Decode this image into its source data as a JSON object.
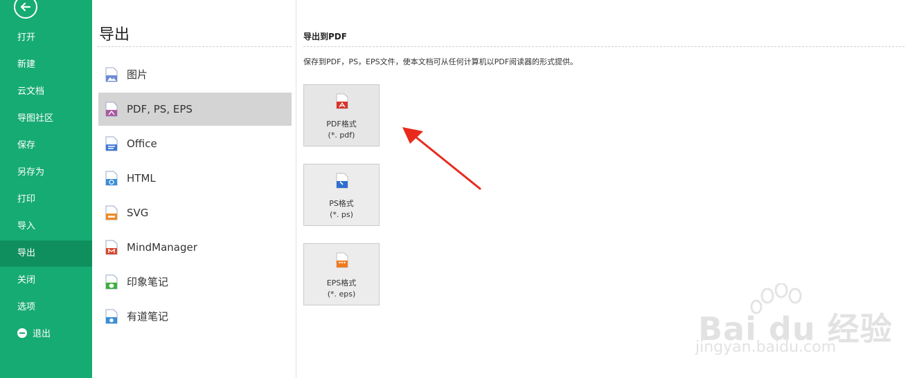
{
  "sidebar": {
    "items": [
      {
        "label": "打开"
      },
      {
        "label": "新建"
      },
      {
        "label": "云文档"
      },
      {
        "label": "导图社区"
      },
      {
        "label": "保存"
      },
      {
        "label": "另存为"
      },
      {
        "label": "打印"
      },
      {
        "label": "导入"
      },
      {
        "label": "导出"
      },
      {
        "label": "关闭"
      },
      {
        "label": "选项"
      },
      {
        "label": "退出"
      }
    ],
    "active": "导出",
    "color": "#17ab74",
    "active_color": "#0f8f5e"
  },
  "middle": {
    "title": "导出",
    "formats": [
      {
        "label": "图片",
        "icon": "image-file-icon"
      },
      {
        "label": "PDF, PS, EPS",
        "icon": "pdf-file-icon"
      },
      {
        "label": "Office",
        "icon": "office-file-icon"
      },
      {
        "label": "HTML",
        "icon": "html-file-icon"
      },
      {
        "label": "SVG",
        "icon": "svg-file-icon"
      },
      {
        "label": "MindManager",
        "icon": "mindmanager-file-icon"
      },
      {
        "label": "印象笔记",
        "icon": "evernote-file-icon"
      },
      {
        "label": "有道笔记",
        "icon": "youdao-file-icon"
      }
    ],
    "selected": "PDF, PS, EPS"
  },
  "right": {
    "title": "导出到PDF",
    "description": "保存到PDF，PS，EPS文件，使本文档可从任何计算机以PDF阅读器的形式提供。",
    "buttons": [
      {
        "name": "PDF格式",
        "ext": "(*. pdf)"
      },
      {
        "name": "PS格式",
        "ext": "(*. ps)"
      },
      {
        "name": "EPS格式",
        "ext": "(*. eps)"
      }
    ]
  },
  "watermark": {
    "brand": "Bai du 经验",
    "url": "jingyan.baidu.com"
  }
}
